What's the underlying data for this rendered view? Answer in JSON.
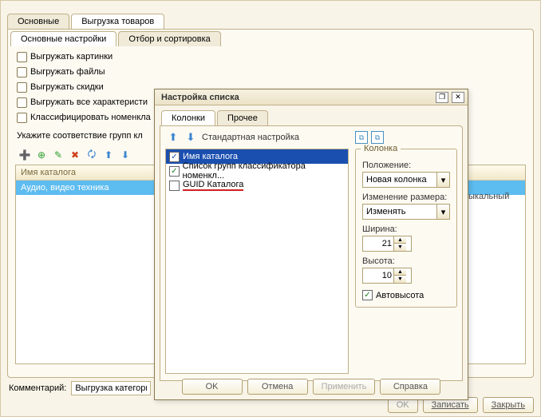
{
  "topTabs": {
    "main": "Основные",
    "export": "Выгрузка товаров"
  },
  "subTabs": {
    "settings": "Основные настройки",
    "filter": "Отбор и сортировка"
  },
  "options": {
    "unloadPictures": "Выгружать картинки",
    "unloadFiles": "Выгружать файлы",
    "unloadDiscounts": "Выгружать скидки",
    "unloadAllChars": "Выгружать все характеристи",
    "classify": "Классифицировать номенкла"
  },
  "hint": "Укажите соответствие групп кл",
  "grid": {
    "header": "Имя каталога",
    "row1": "Аудио, видео техника",
    "extra": "ыкальный"
  },
  "comment": {
    "label": "Комментарий:",
    "value": "Выгрузка категори"
  },
  "bottomButtons": {
    "ok": "OK",
    "save": "Записать",
    "close": "Закрыть"
  },
  "dialog": {
    "title": "Настройка списка",
    "tabs": {
      "columns": "Колонки",
      "other": "Прочее"
    },
    "stdLink": "Стандартная настройка",
    "list": {
      "catalogName": "Имя каталога",
      "groupList": "Список групп классификатора номенкл...",
      "guid": "GUID Каталога"
    },
    "group": {
      "title": "Колонка",
      "positionLabel": "Положение:",
      "positionValue": "Новая колонка",
      "resizeLabel": "Изменение размера:",
      "resizeValue": "Изменять",
      "widthLabel": "Ширина:",
      "widthValue": "21",
      "heightLabel": "Высота:",
      "heightValue": "10",
      "autoHeight": "Автовысота"
    },
    "buttons": {
      "ok": "OK",
      "cancel": "Отмена",
      "apply": "Применить",
      "help": "Справка"
    }
  }
}
